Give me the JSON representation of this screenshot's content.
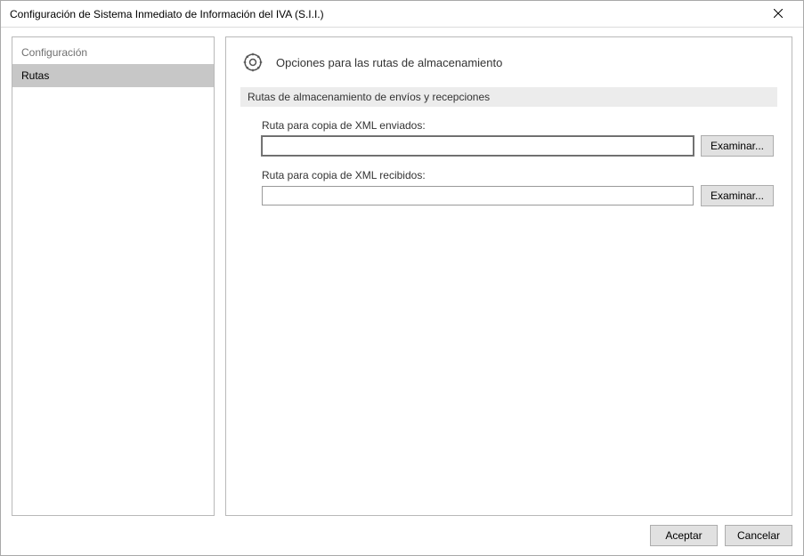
{
  "window": {
    "title": "Configuración de Sistema Inmediato de Información del IVA (S.I.I.)"
  },
  "sidebar": {
    "header": "Configuración",
    "items": [
      {
        "label": "Rutas",
        "selected": true
      }
    ]
  },
  "content": {
    "heading": "Opciones para las rutas de almacenamiento",
    "section_title": "Rutas de almacenamiento de envíos y recepciones",
    "fields": {
      "sent": {
        "label": "Ruta para copia de XML enviados:",
        "value": "",
        "browse_label": "Examinar..."
      },
      "received": {
        "label": "Ruta para copia de XML recibidos:",
        "value": "",
        "browse_label": "Examinar..."
      }
    }
  },
  "footer": {
    "accept_label": "Aceptar",
    "cancel_label": "Cancelar"
  }
}
